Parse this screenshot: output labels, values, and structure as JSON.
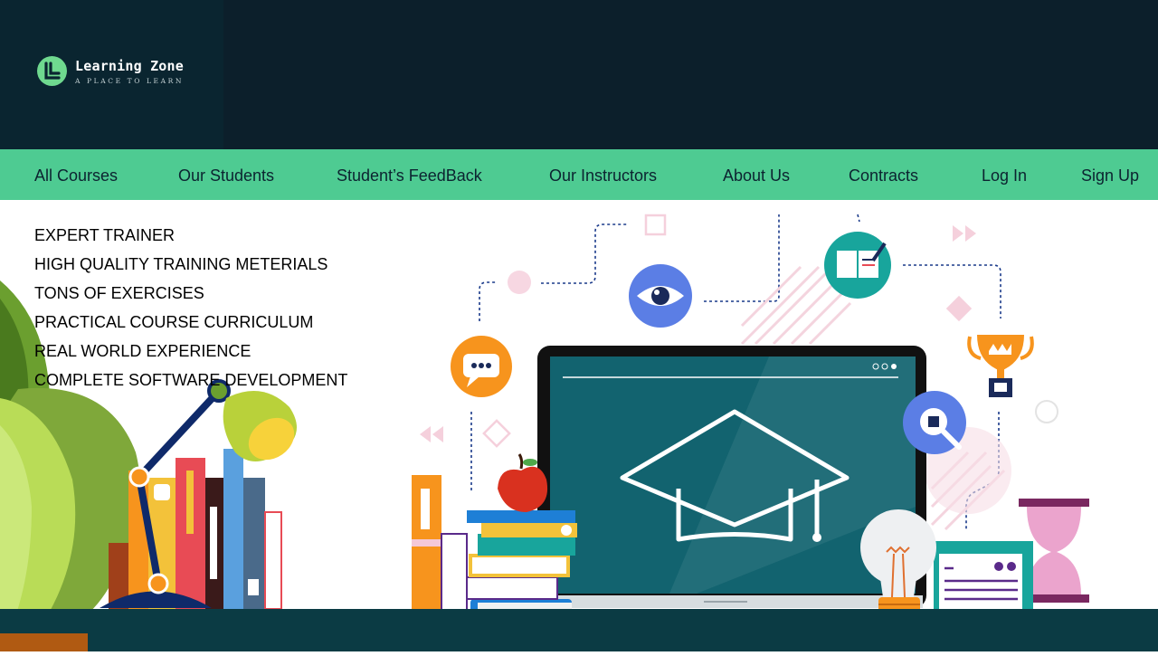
{
  "brand": {
    "name": "Learning Zone",
    "tagline": "A PLACE TO LEARN"
  },
  "nav": {
    "items": [
      {
        "label": "All Courses",
        "icon": null
      },
      {
        "label": "Our Students"
      },
      {
        "label": "Student’s FeedBack"
      },
      {
        "label": "Our Instructors"
      },
      {
        "label": "About Us"
      },
      {
        "label": "Contracts"
      },
      {
        "label": "Log In"
      },
      {
        "label": "Sign Up"
      }
    ]
  },
  "features": [
    "EXPERT TRAINER",
    "HIGH QUALITY TRAINING METERIALS",
    "TONS OF EXERCISES",
    "PRACTICAL COURSE CURRICULUM",
    "REAL WORLD EXPERIENCE",
    "COMPLETE SOFTWARE DEVELOPMENT"
  ],
  "colors": {
    "header_bg": "#0c1f2b",
    "nav_bg": "#4ecb92",
    "logo_accent": "#6fd98f",
    "floor": "#0b3b44"
  },
  "illustration": {
    "icons": [
      "chat-icon",
      "eye-icon",
      "book-icon",
      "trophy-icon",
      "search-icon",
      "graduation-cap-icon",
      "lightbulb-icon",
      "calendar-icon",
      "hourglass-icon",
      "apple-icon",
      "desk-lamp-icon",
      "plant-icon"
    ]
  }
}
